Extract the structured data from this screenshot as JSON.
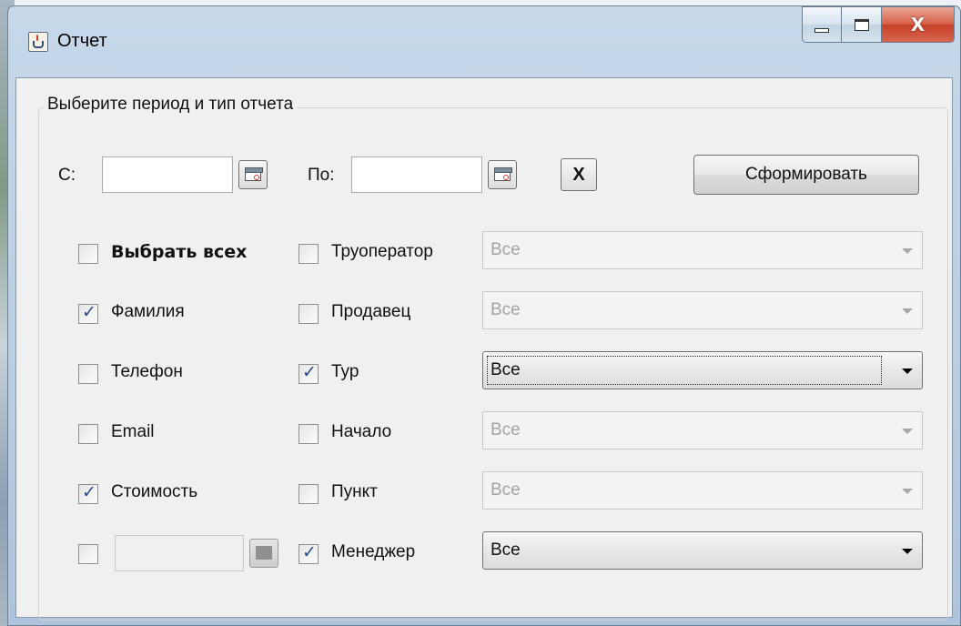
{
  "window": {
    "title": "Отчет",
    "controls": {
      "minimize": "minimize-icon",
      "maximize": "maximize-icon",
      "close": "close-icon"
    }
  },
  "group": {
    "legend": "Выберите период и тип отчета"
  },
  "period": {
    "from_label": "С:",
    "from_value": "",
    "to_label": "По:",
    "to_value": "",
    "clear_label": "X",
    "generate_label": "Сформировать"
  },
  "checkboxes_left": [
    {
      "label": "Выбрать всех",
      "checked": false,
      "bold": true
    },
    {
      "label": "Фамилия",
      "checked": true
    },
    {
      "label": "Телефон",
      "checked": false
    },
    {
      "label": "Email",
      "checked": false
    },
    {
      "label": "Стоимость",
      "checked": true
    },
    {
      "label": "",
      "checked": false
    }
  ],
  "filters": [
    {
      "label": "Труоператор",
      "checked": false,
      "value": "Все",
      "enabled": false
    },
    {
      "label": "Продавец",
      "checked": false,
      "value": "Все",
      "enabled": false
    },
    {
      "label": "Тур",
      "checked": true,
      "value": "Все",
      "enabled": true,
      "focused": true
    },
    {
      "label": "Начало",
      "checked": false,
      "value": "Все",
      "enabled": false
    },
    {
      "label": "Пункт",
      "checked": false,
      "value": "Все",
      "enabled": false
    },
    {
      "label": "Менеджер",
      "checked": true,
      "value": "Все",
      "enabled": true
    }
  ]
}
